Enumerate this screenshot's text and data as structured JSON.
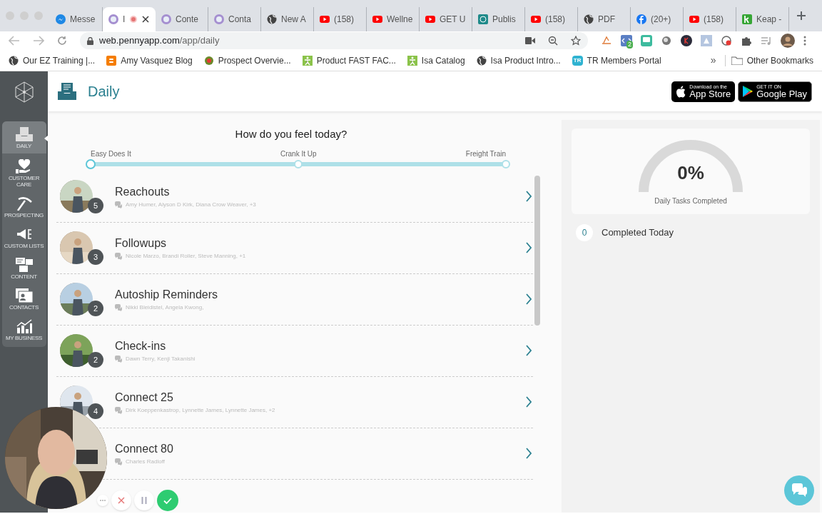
{
  "browser": {
    "tabs": [
      {
        "title": "Messe",
        "kind": "messenger",
        "selected": false
      },
      {
        "title": "I",
        "kind": "penny",
        "selected": true
      },
      {
        "title": "Conte",
        "kind": "penny",
        "selected": false
      },
      {
        "title": "Conta",
        "kind": "penny",
        "selected": false
      },
      {
        "title": "New A",
        "kind": "globe",
        "selected": false
      },
      {
        "title": "(158)",
        "kind": "youtube",
        "selected": false
      },
      {
        "title": "Wellne",
        "kind": "youtube",
        "selected": false
      },
      {
        "title": "GET U",
        "kind": "youtube",
        "selected": false
      },
      {
        "title": "Publis",
        "kind": "publish",
        "selected": false
      },
      {
        "title": "(158)",
        "kind": "youtube",
        "selected": false
      },
      {
        "title": "PDF",
        "kind": "globe",
        "selected": false
      },
      {
        "title": "(20+)",
        "kind": "facebook",
        "selected": false
      },
      {
        "title": "(158)",
        "kind": "youtube",
        "selected": false
      },
      {
        "title": "Keap -",
        "kind": "keap",
        "selected": false
      }
    ],
    "url_host": "web.pennyapp.com",
    "url_path": "/app/daily",
    "extension_badge": "2",
    "bookmarks": [
      {
        "label": "Our EZ Training |...",
        "kind": "globe"
      },
      {
        "label": "Amy Vasquez Blog",
        "kind": "blogger"
      },
      {
        "label": "Prospect Overvie...",
        "kind": "prospect"
      },
      {
        "label": "Product FAST FAC...",
        "kind": "isa"
      },
      {
        "label": "Isa Catalog",
        "kind": "isa"
      },
      {
        "label": "Isa Product Intro...",
        "kind": "globe"
      },
      {
        "label": "TR Members Portal",
        "kind": "tr",
        "icon_text": "TR"
      }
    ],
    "overflow": "»",
    "other_bookmarks": "Other Bookmarks"
  },
  "sidebar": {
    "items": [
      {
        "label": "DAILY",
        "kind": "daily",
        "selected": true
      },
      {
        "label": "CUSTOMER CARE",
        "kind": "care",
        "selected": false
      },
      {
        "label": "PROSPECTING",
        "kind": "pick",
        "selected": false
      },
      {
        "label": "CUSTOM LISTS",
        "kind": "megaphone",
        "selected": false
      },
      {
        "label": "CONTENT",
        "kind": "content",
        "selected": false
      },
      {
        "label": "CONTACTS",
        "kind": "contacts",
        "selected": false
      },
      {
        "label": "MY BUSINESS",
        "kind": "chart",
        "selected": false
      }
    ]
  },
  "header": {
    "title": "Daily",
    "app_store": {
      "small": "Download on the",
      "big": "App Store"
    },
    "google_play": {
      "small": "GET IT ON",
      "big": "Google Play"
    }
  },
  "mood": {
    "question": "How do you feel today?",
    "labels": [
      "Easy Does It",
      "Crank It Up",
      "Freight Train"
    ],
    "level": 0
  },
  "tasks": [
    {
      "title": "Reachouts",
      "count": "5",
      "contacts": "Amy Humer, Alyson D Kirk, Diana Crow Weaver, +3"
    },
    {
      "title": "Followups",
      "count": "3",
      "contacts": "Nicole Marzo, Brandi Roller, Steve Manning, +1"
    },
    {
      "title": "Autoship Reminders",
      "count": "2",
      "contacts": "Nikki Bleidistel, Angela Kwong,"
    },
    {
      "title": "Check-ins",
      "count": "2",
      "contacts": "Dawn Terry, Kenji Takanishi"
    },
    {
      "title": "Connect 25",
      "count": "4",
      "contacts": "Dirk Koeppenkastrop, Lynnette James, Lynnette James, +2"
    },
    {
      "title": "Connect 80",
      "contacts": "Charles Radloff"
    }
  ],
  "progress": {
    "value": "0%",
    "caption": "Daily Tasks Completed"
  },
  "completed": {
    "count": "0",
    "label": "Completed Today"
  }
}
